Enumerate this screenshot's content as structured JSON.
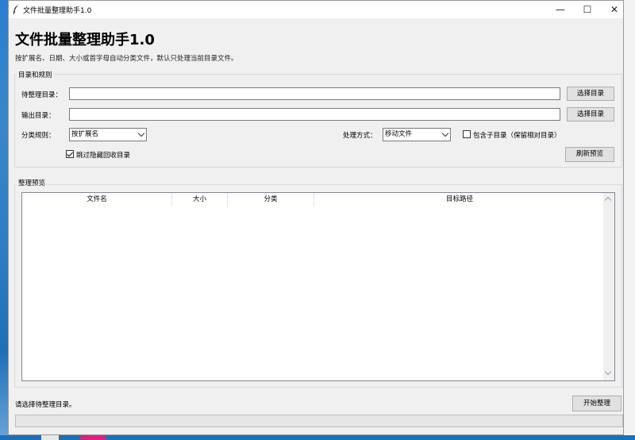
{
  "window": {
    "title": "文件批量整理助手1.0",
    "minimize_glyph": "—",
    "maximize_glyph": "☐",
    "close_glyph": "✕"
  },
  "header": {
    "heading": "文件批量整理助手1.0",
    "subtitle": "按扩展名、日期、大小或首字母自动分类文件，默认只处理当前目录文件。"
  },
  "settings": {
    "group_title": "目录和规则",
    "source_label": "待整理目录：",
    "source_value": "",
    "source_browse": "选择目录",
    "output_label": "输出目录：",
    "output_value": "",
    "output_browse": "选择目录",
    "rule_label": "分类规则：",
    "rule_value": "按扩展名",
    "mode_label": "处理方式：",
    "mode_value": "移动文件",
    "include_subdirs_label": "包含子目录（保留相对目录）",
    "include_subdirs_checked": false,
    "skip_hidden_label": "跳过隐藏回收目录",
    "skip_hidden_checked": true,
    "refresh_button": "刷新预览"
  },
  "preview": {
    "group_title": "整理预览",
    "columns": [
      "文件名",
      "大小",
      "分类",
      "目标路径"
    ],
    "rows": []
  },
  "footer": {
    "status": "请选择待整理目录。",
    "start_button": "开始整理",
    "progress": 0
  },
  "icons": {
    "app": "feather-icon",
    "checkbox_tick": "check-icon"
  }
}
